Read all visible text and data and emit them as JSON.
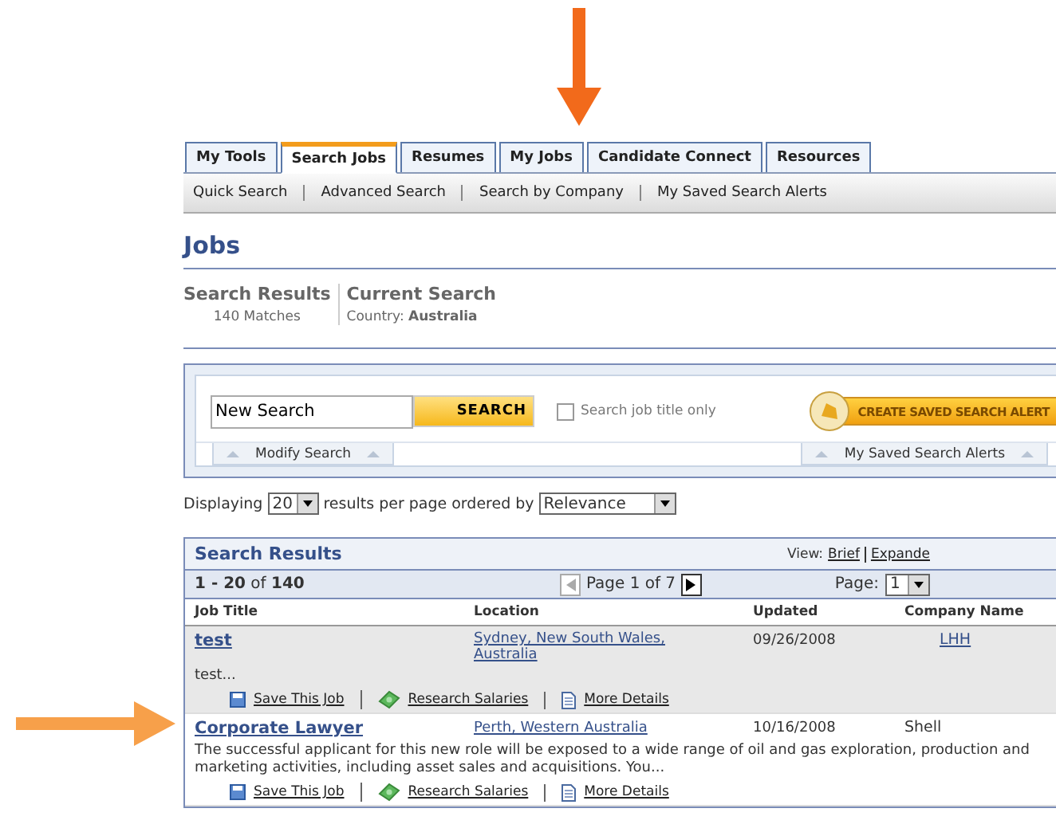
{
  "tabs": [
    {
      "label": "My Tools",
      "selected": false
    },
    {
      "label": "Search Jobs",
      "selected": true
    },
    {
      "label": "Resumes",
      "selected": false
    },
    {
      "label": "My Jobs",
      "selected": false
    },
    {
      "label": "Candidate Connect",
      "selected": false
    },
    {
      "label": "Resources",
      "selected": false
    }
  ],
  "subnav": [
    "Quick Search",
    "Advanced Search",
    "Search by Company",
    "My Saved Search Alerts"
  ],
  "page_title": "Jobs",
  "summary": {
    "results_label": "Search Results",
    "matches": "140 Matches",
    "current_label": "Current Search",
    "criteria_label": "Country:",
    "criteria_value": "Australia"
  },
  "search": {
    "value": "New Search",
    "button": "SEARCH",
    "title_only": {
      "label": "Search job title only",
      "checked": false
    },
    "alert_button": "CREATE SAVED SEARCH ALERT",
    "left_tab": "Modify Search",
    "right_tab": "My Saved Search Alerts"
  },
  "display": {
    "prefix": "Displaying",
    "per_page": "20",
    "middle": "results per page ordered by",
    "order": "Relevance"
  },
  "results": {
    "title": "Search Results",
    "view_label": "View:",
    "views": [
      "Brief",
      "Expande"
    ],
    "range": "**1 - 20** of **140**",
    "page_text": "Page 1 of 7",
    "page_label": "Page:",
    "page_value": "1",
    "columns": [
      "Job Title",
      "Location",
      "Updated",
      "Company Name"
    ],
    "rows": [
      {
        "title": "test",
        "location": "Sydney, New South Wales, Australia",
        "updated": "09/26/2008",
        "company": "LHH",
        "company_link": true,
        "selected": true,
        "summary": "test...",
        "actions": [
          {
            "kind": "save",
            "label": "Save This Job"
          },
          {
            "kind": "salary",
            "label": "Research Salaries"
          },
          {
            "kind": "details",
            "label": "More Details"
          }
        ]
      },
      {
        "title": "Corporate Lawyer",
        "location": "Perth, Western Australia",
        "updated": "10/16/2008",
        "company": "Shell",
        "company_link": false,
        "selected": false,
        "summary": "The successful applicant for this new role will be exposed to a wide range of oil and gas exploration, production and marketing activities, including asset sales and acquisitions. You...",
        "actions": [
          {
            "kind": "save",
            "label": "Save This Job"
          },
          {
            "kind": "salary",
            "label": "Research Salaries"
          },
          {
            "kind": "details",
            "label": "More Details"
          }
        ]
      }
    ]
  }
}
